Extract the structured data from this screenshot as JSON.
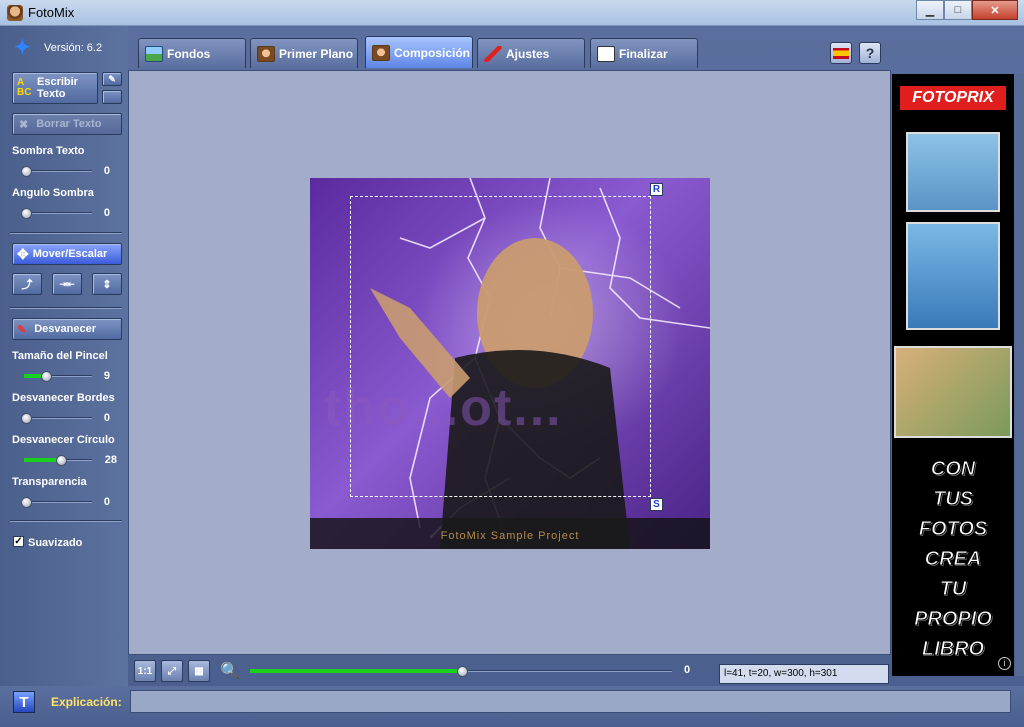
{
  "window": {
    "title": "FotoMix",
    "minimize_label": "▁",
    "maximize_label": "□",
    "close_label": "✕"
  },
  "sidebar": {
    "version": "Versión: 6.2",
    "write_text_label": "Escribir Texto",
    "erase_text_label": "Borrar Texto",
    "shadow_text_label": "Sombra Texto",
    "shadow_text_value": "0",
    "shadow_angle_label": "Angulo Sombra",
    "shadow_angle_value": "0",
    "move_scale_label": "Mover/Escalar",
    "fade_label": "Desvanecer",
    "brush_size_label": "Tamaño del Pincel",
    "brush_size_value": "9",
    "fade_edges_label": "Desvanecer Bordes",
    "fade_edges_value": "0",
    "fade_circle_label": "Desvanecer Círculo",
    "fade_circle_value": "28",
    "transparency_label": "Transparencia",
    "transparency_value": "0",
    "smooth_label": "Suavizado",
    "smooth_checked": true
  },
  "tabs": [
    {
      "label": "Fondos",
      "active": false
    },
    {
      "label": "Primer Plano",
      "active": false
    },
    {
      "label": "Composición",
      "active": true
    },
    {
      "label": "Ajustes",
      "active": false
    },
    {
      "label": "Finalizar",
      "active": false
    }
  ],
  "toolbar_right": {
    "language_icon": "spain-flag-icon",
    "help_label": "?"
  },
  "canvas": {
    "handle_r": "R",
    "handle_s": "S",
    "watermark": "FotoMix Sample Project",
    "ghost_text": "tho...ot..."
  },
  "bottom": {
    "actual_size_label": "1:1",
    "zoom_value": "0",
    "coords": "l=41, t=20, w=300, h=301"
  },
  "ad": {
    "brand": "FOTOPRIX",
    "slogan": [
      "CON",
      "TUS",
      "FOTOS",
      "CREA",
      "TU",
      "PROPIO",
      "LIBRO"
    ],
    "info_label": "i"
  },
  "status": {
    "t_label": "T",
    "explanation_label": "Explicación:",
    "explanation_text": ""
  }
}
